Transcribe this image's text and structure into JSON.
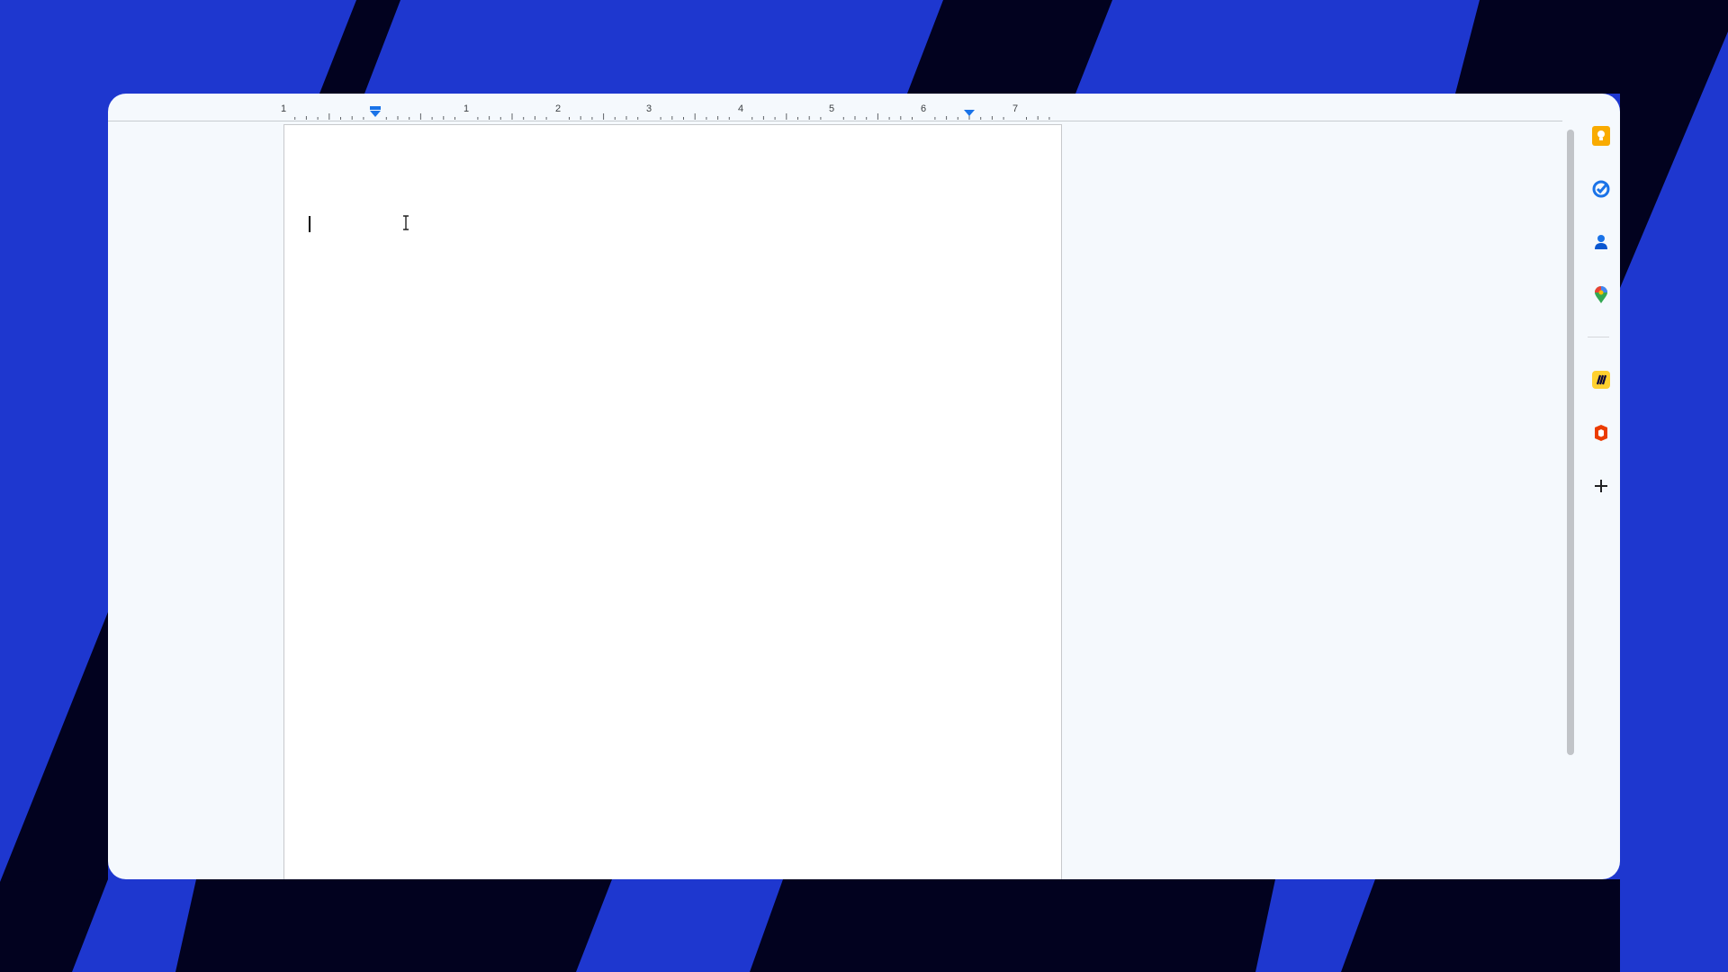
{
  "ruler": {
    "numbers": [
      "1",
      "1",
      "2",
      "3",
      "4",
      "5",
      "6",
      "7"
    ]
  },
  "document": {
    "content": ""
  },
  "side_panel": {
    "apps": [
      {
        "name": "keep-icon",
        "color": "#f9ab00"
      },
      {
        "name": "tasks-icon",
        "color": "#1a73e8"
      },
      {
        "name": "contacts-icon",
        "color": "#1a73e8"
      },
      {
        "name": "maps-icon",
        "color": "#34a853"
      },
      {
        "name": "miro-icon",
        "color": "#ffd02f"
      },
      {
        "name": "office-icon",
        "color": "#eb3c00"
      },
      {
        "name": "add-icon",
        "color": "#202124"
      }
    ]
  },
  "colors": {
    "background": "#1e37cf",
    "stripe": "#02021f",
    "accent": "#1a73e8"
  }
}
